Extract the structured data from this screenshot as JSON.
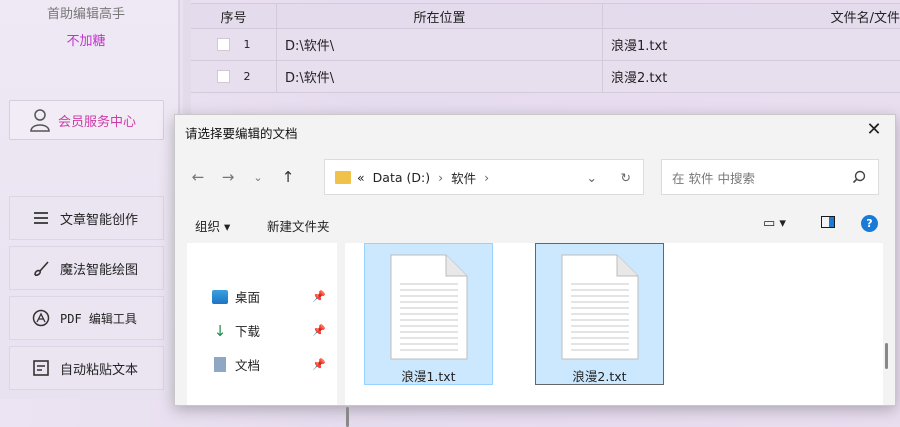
{
  "sidebar": {
    "app_title": "首助编辑高手",
    "app_subtitle": "不加糖",
    "member_center": "会员服务中心",
    "items": [
      {
        "label": "文章智能创作",
        "icon": "list-icon"
      },
      {
        "label": "魔法智能绘图",
        "icon": "brush-icon"
      },
      {
        "label": "PDF 编辑工具",
        "icon": "pdf-icon"
      },
      {
        "label": "自动粘贴文本",
        "icon": "paste-icon"
      }
    ]
  },
  "table": {
    "headers": [
      "序号",
      "所在位置",
      "文件名/文件"
    ],
    "rows": [
      {
        "index": "1",
        "location": "D:\\软件\\",
        "filename": "浪漫1.txt"
      },
      {
        "index": "2",
        "location": "D:\\软件\\",
        "filename": "浪漫2.txt"
      }
    ]
  },
  "dialog": {
    "title": "请选择要编辑的文档",
    "address": {
      "prefix": "«",
      "drive": "Data (D:)",
      "folder": "软件"
    },
    "search_placeholder": "在 软件 中搜索",
    "toolbar": {
      "organize": "组织 ▾",
      "new_folder": "新建文件夹"
    },
    "nav_items": [
      {
        "label": "桌面",
        "icon": "desktop-icon"
      },
      {
        "label": "下载",
        "icon": "download-icon"
      },
      {
        "label": "文档",
        "icon": "documents-icon"
      }
    ],
    "files": [
      {
        "name": "浪漫1.txt"
      },
      {
        "name": "浪漫2.txt"
      }
    ]
  },
  "colors": {
    "accent": "#c035c8",
    "selection": "#cce8ff",
    "folder": "#f0c24a"
  }
}
